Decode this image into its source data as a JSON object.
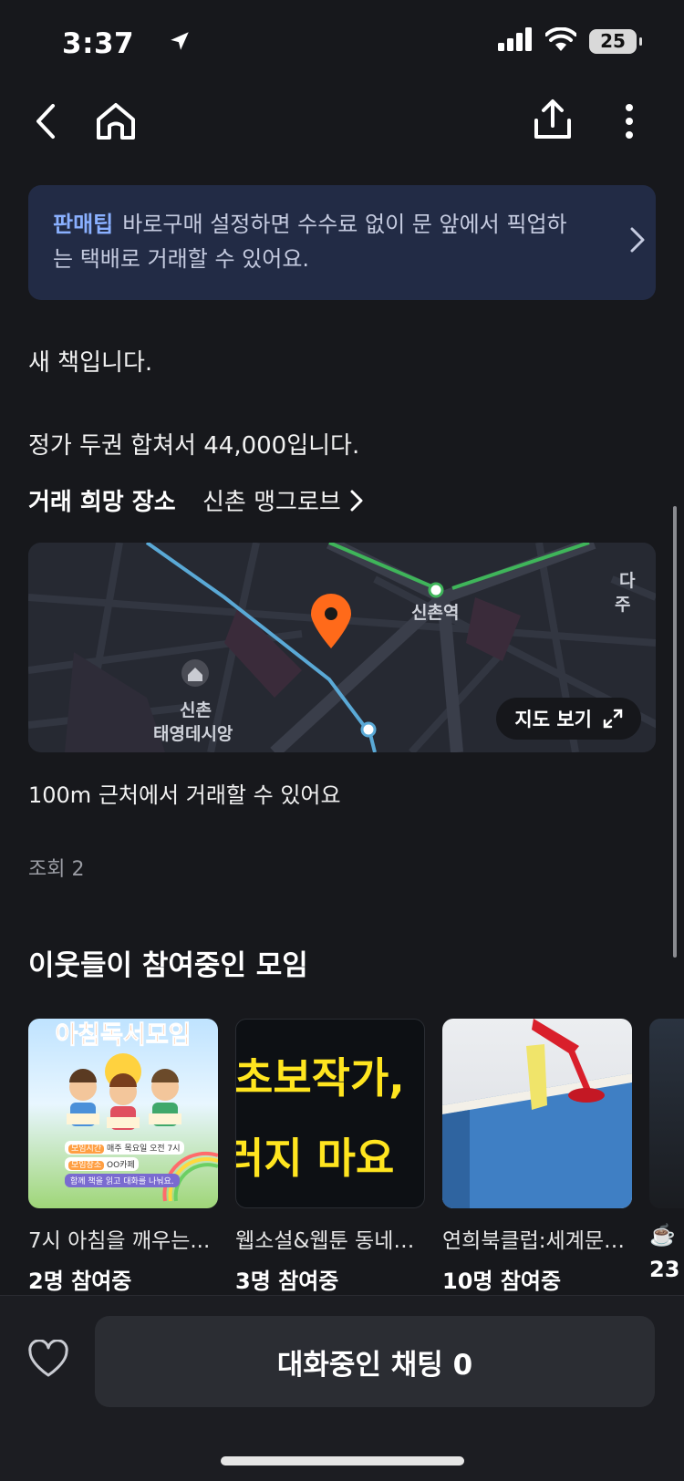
{
  "status_bar": {
    "time": "3:37",
    "battery": "25"
  },
  "tip": {
    "tag": "판매팁",
    "text": "바로구매 설정하면 수수료 없이 문 앞에서 픽업하는 택배로 거래할 수 있어요."
  },
  "description": {
    "line1": "새 책입니다.",
    "line2": "정가 두권 합쳐서 44,000입니다."
  },
  "place": {
    "label": "거래 희망 장소",
    "value": "신촌 맹그로브"
  },
  "map": {
    "station_label": "신촌역",
    "landmark_label_1": "신촌",
    "landmark_label_2": "태영데시앙",
    "edge_label_1": "다",
    "edge_label_2": "주",
    "view_button": "지도 보기"
  },
  "nearby_note": "100m 근처에서 거래할 수 있어요",
  "views": "조회 2",
  "groups": {
    "title": "이웃들이 참여중인 모임",
    "items": [
      {
        "title": "7시 아침을 깨우는...",
        "count": "2명 참여중",
        "thumb_title": "아침독서모임",
        "thumb_line1": "모임시간",
        "thumb_line1b": "매주 목요일 오전 7시",
        "thumb_line2": "모임장소",
        "thumb_line2b": "OO카페",
        "thumb_line3": "함께 책을 읽고 대화를 나눠요."
      },
      {
        "title": "웹소설&웹툰 동네…",
        "count": "3명 참여중",
        "thumb_line1": "초보작가,",
        "thumb_line2": "러지 마요"
      },
      {
        "title": "연희북클럽:세계문…",
        "count": "10명 참여중"
      },
      {
        "title": "☕️",
        "count": "23"
      }
    ]
  },
  "bottom": {
    "chat_button": "대화중인 채팅 0"
  },
  "colors": {
    "background": "#17181c",
    "tip_bg": "#222b45",
    "tip_accent": "#8ab0ff",
    "pin": "#ff6a1a"
  }
}
